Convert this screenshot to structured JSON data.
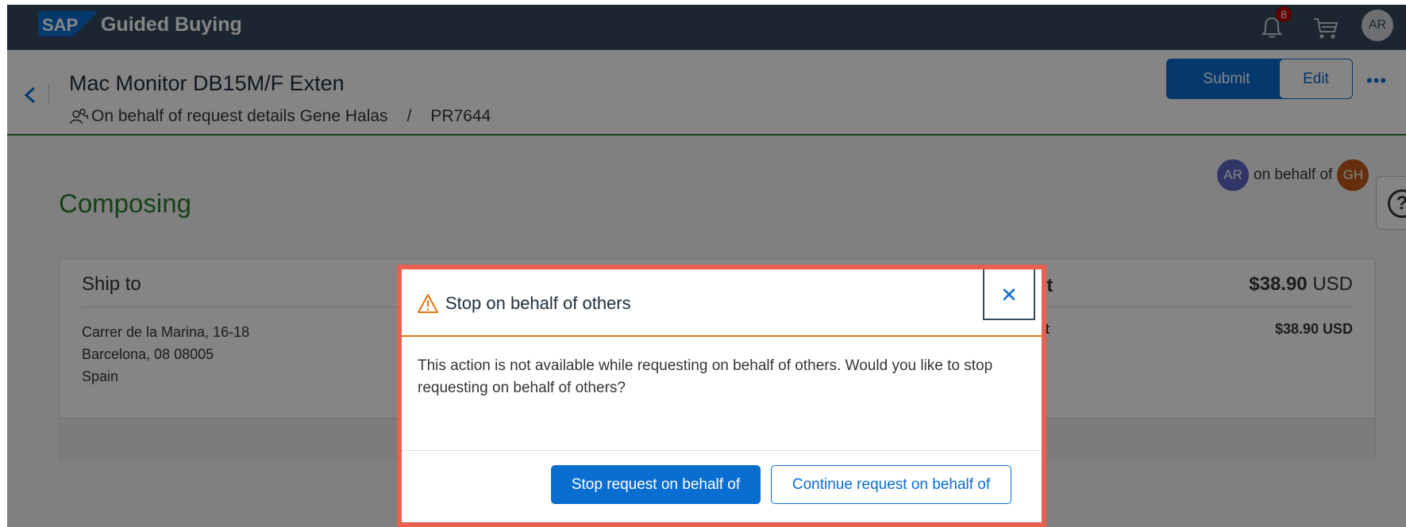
{
  "shell": {
    "logo": "SAP",
    "app_title": "Guided Buying",
    "notification_count": "8",
    "user_initials": "AR",
    "icons": [
      "bell-icon",
      "cart-icon"
    ]
  },
  "header": {
    "title": "Mac Monitor DB15M/F Exten",
    "subtitle_prefix": "On behalf of request details Gene Halas",
    "subtitle_sep": "/",
    "request_id": "PR7644",
    "submit_label": "Submit",
    "edit_label": "Edit",
    "more_label": "•••"
  },
  "content": {
    "onbehalf": {
      "requester_initials": "AR",
      "text": "on behalf of",
      "beneficiary_initials": "GH"
    },
    "status": "Composing",
    "ship_to": {
      "title": "Ship to",
      "line1": "Carrer de la Marina, 16-18",
      "line2": "Barcelona, 08  08005",
      "line3": "Spain"
    },
    "cost": {
      "label": "st",
      "total_amount": "$38.90",
      "total_currency": "USD",
      "sub_label": "nt",
      "sub_amount": "$38.90 USD"
    }
  },
  "dialog": {
    "title": "Stop on behalf of others",
    "close_label": "✕",
    "message": "This action is not available while requesting on behalf of others. Would you like to stop requesting on behalf of others?",
    "primary_label": "Stop request on behalf of",
    "secondary_label": "Continue request on behalf of"
  },
  "colors": {
    "shell_bg": "#354a5f",
    "brand_blue": "#0a6ed1",
    "status_green": "#2b7d2b",
    "highlight_red": "#e8604f",
    "warning_orange": "#e9730c"
  }
}
